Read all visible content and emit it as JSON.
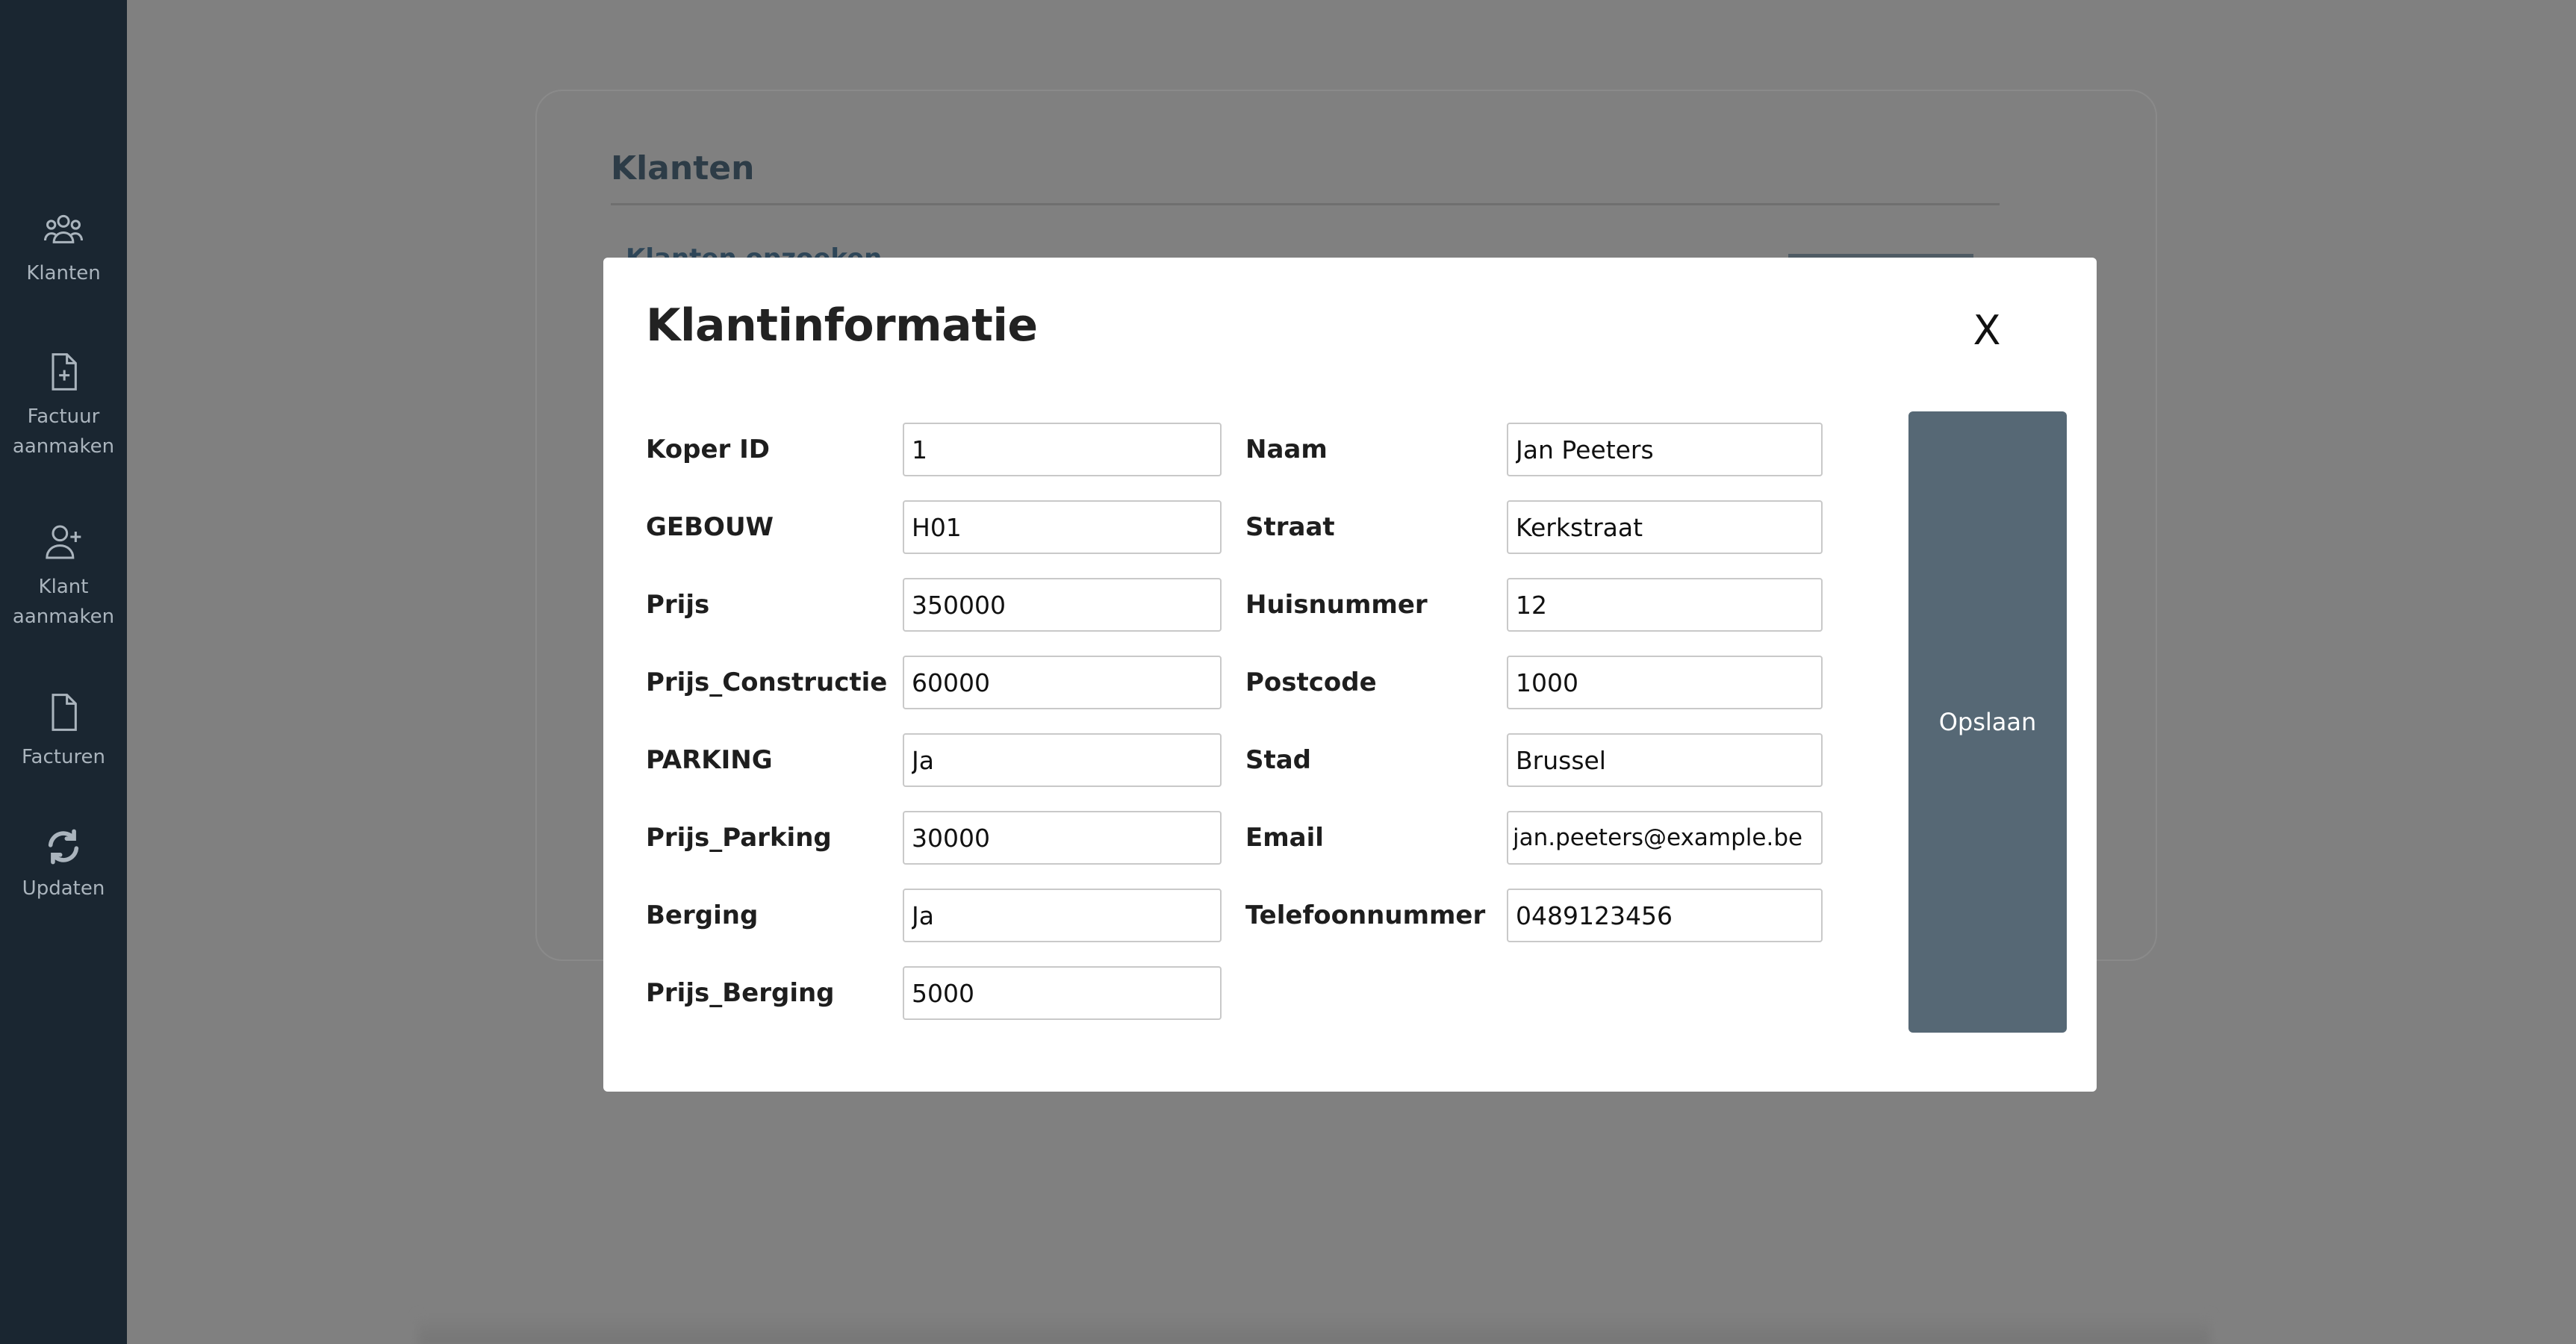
{
  "sidebar": {
    "items": [
      {
        "label_lines": [
          "Klanten"
        ],
        "icon": "users-icon"
      },
      {
        "label_lines": [
          "Factuur",
          "aanmaken"
        ],
        "icon": "file-plus-icon"
      },
      {
        "label_lines": [
          "Klant",
          "aanmaken"
        ],
        "icon": "user-plus-icon"
      },
      {
        "label_lines": [
          "Facturen"
        ],
        "icon": "file-icon"
      },
      {
        "label_lines": [
          "Updaten"
        ],
        "icon": "refresh-icon"
      }
    ]
  },
  "background": {
    "title": "Klanten",
    "subtitle": "Klanten opzoeken"
  },
  "modal": {
    "title": "Klantinformatie",
    "close_label": "X",
    "save_label": "Opslaan",
    "fields_left": [
      {
        "label": "Koper ID",
        "value": "1"
      },
      {
        "label": "GEBOUW",
        "value": "H01"
      },
      {
        "label": "Prijs",
        "value": "350000"
      },
      {
        "label": "Prijs_Constructie",
        "value": "60000"
      },
      {
        "label": "PARKING",
        "value": "Ja"
      },
      {
        "label": "Prijs_Parking",
        "value": "30000"
      },
      {
        "label": "Berging",
        "value": "Ja"
      },
      {
        "label": "Prijs_Berging",
        "value": "5000"
      }
    ],
    "fields_right": [
      {
        "label": "Naam",
        "value": "Jan Peeters"
      },
      {
        "label": "Straat",
        "value": "Kerkstraat"
      },
      {
        "label": "Huisnummer",
        "value": "12"
      },
      {
        "label": "Postcode",
        "value": "1000"
      },
      {
        "label": "Stad",
        "value": "Brussel"
      },
      {
        "label": "Email",
        "value": "jan.peeters@example.be"
      },
      {
        "label": "Telefoonnummer",
        "value": "0489123456"
      }
    ]
  },
  "colors": {
    "sidebar_bg": "#1a2631",
    "overlay": "#808080",
    "save_button": "#566875"
  }
}
